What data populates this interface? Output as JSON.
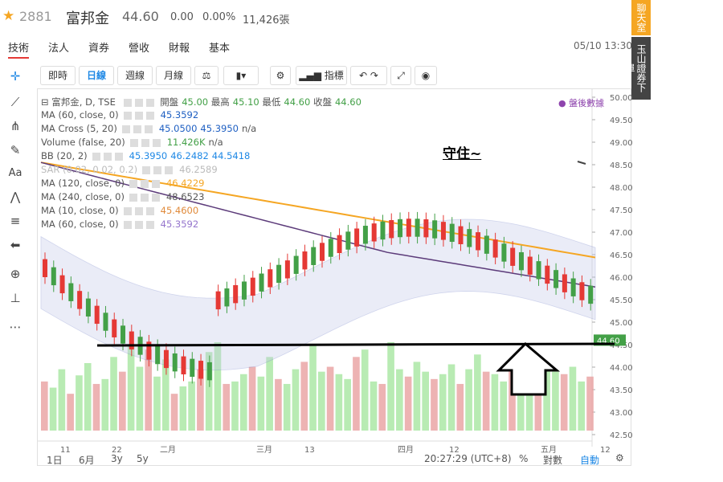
{
  "header": {
    "code": "2881",
    "name": "富邦金",
    "price": "44.60",
    "change": "0.00",
    "change_pct": "0.00%",
    "volume": "11,426張",
    "datetime": "05/10 13:30"
  },
  "tabs": [
    "技術",
    "法人",
    "資券",
    "營收",
    "財報",
    "基本"
  ],
  "side_buttons": {
    "chat": "聊天室",
    "broker": "玉山證券下單"
  },
  "toolbar": {
    "buttons": [
      "即時",
      "日線",
      "週線",
      "月線",
      "指標"
    ],
    "selected": "日線"
  },
  "legend": {
    "symbol": "富邦金, D, TSE",
    "open_label": "開盤",
    "open": "45.00",
    "high_label": "最高",
    "high": "45.10",
    "low_label": "最低",
    "low": "44.60",
    "close_label": "收盤",
    "close": "44.60",
    "after_hours": "● 盤後數據",
    "ma60": {
      "label": "MA (60, close, 0)",
      "value": "45.3592"
    },
    "macross": {
      "label": "MA Cross (5, 20)",
      "v1": "45.0500",
      "v2": "45.3950",
      "v3": "n/a"
    },
    "volume": {
      "label": "Volume (false, 20)",
      "v1": "11.426K",
      "v2": "n/a"
    },
    "bb": {
      "label": "BB (20, 2)",
      "v1": "45.3950",
      "v2": "46.2482",
      "v3": "44.5418"
    },
    "sar": {
      "label": "SAR (0.02, 0.02, 0.2)",
      "value": "46.2589"
    },
    "ma120": {
      "label": "MA (120, close, 0)",
      "value": "46.4229"
    },
    "ma240": {
      "label": "MA (240, close, 0)",
      "value": "48.6523"
    },
    "ma10": {
      "label": "MA (10, close, 0)",
      "value": "45.4600"
    },
    "ma60b": {
      "label": "MA (60, close, 0)",
      "value": "45.3592"
    }
  },
  "annotation": "守住~",
  "price_axis": [
    "50.00",
    "49.50",
    "49.00",
    "48.50",
    "48.00",
    "47.50",
    "47.00",
    "46.50",
    "46.00",
    "45.50",
    "45.00",
    "44.50",
    "44.00",
    "43.50",
    "43.00",
    "42.50"
  ],
  "last_price_tag": "44.60",
  "x_axis": [
    "11",
    "22",
    "二月",
    "三月",
    "13",
    "四月",
    "12",
    "五月",
    "12"
  ],
  "bottom": {
    "ranges": [
      "1日",
      "6月",
      "3y",
      "5y"
    ],
    "time": "20:27:29 (UTC+8)",
    "pct": "%",
    "log": "對數",
    "auto": "自動"
  },
  "colors": {
    "up": "#e53935",
    "down": "#43a047",
    "ma120": "#f5a623",
    "ma240": "#5c3b7a",
    "bb_fill": "#c5cae9",
    "macross": "#1e5fc2"
  },
  "chart_data": {
    "type": "candlestick",
    "ylim": [
      42.5,
      50.0
    ],
    "series": [
      {
        "name": "Volume (false, 20)",
        "values": [
          40,
          35,
          50,
          30,
          45,
          55,
          38,
          42,
          60,
          48,
          70,
          52,
          66,
          44,
          58,
          30,
          36,
          40,
          50,
          64,
          72,
          38,
          40,
          46,
          52,
          44,
          60,
          42,
          38,
          50,
          56,
          70,
          48,
          52,
          46,
          42,
          60,
          66,
          40,
          38,
          72,
          50,
          44,
          56,
          48,
          42,
          46,
          54,
          38,
          50,
          62,
          48,
          46,
          40,
          58,
          60,
          44,
          42,
          50,
          48,
          46,
          52,
          40,
          44
        ]
      }
    ]
  }
}
